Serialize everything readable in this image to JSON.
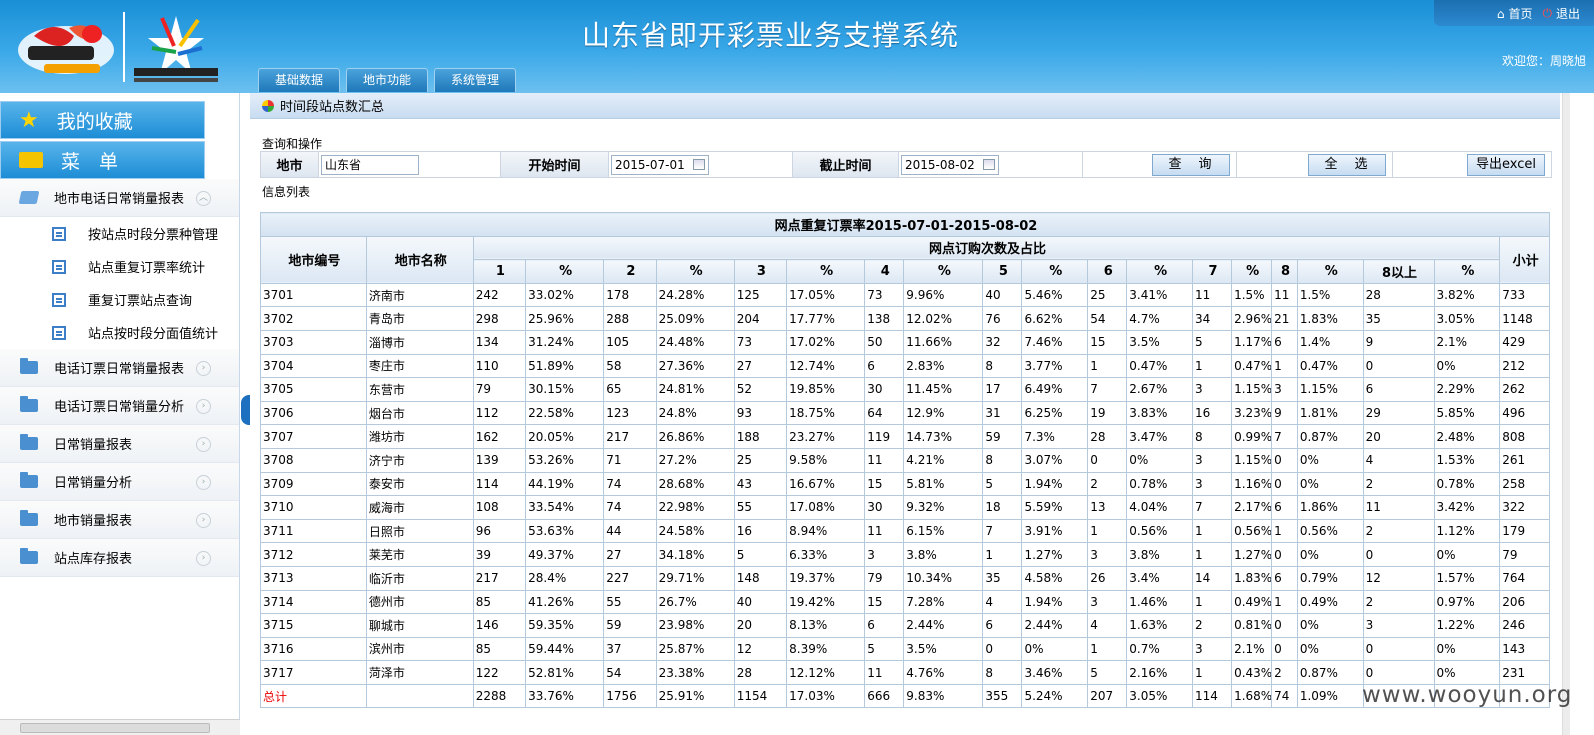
{
  "header": {
    "title": "山东省即开彩票业务支撑系统",
    "nav": [
      "基础数据",
      "地市功能",
      "系统管理"
    ],
    "home_label": "首页",
    "logout_label": "退出",
    "welcome": "欢迎您：周晓旭"
  },
  "sidebar": {
    "favorites_label": "我的收藏",
    "menu_label": "菜　单",
    "groups": [
      {
        "label": "地市电话日常销量报表",
        "expanded": true,
        "items": [
          "按站点时段分票种管理",
          "站点重复订票率统计",
          "重复订票站点查询",
          "站点按时段分面值统计"
        ]
      },
      {
        "label": "电话订票日常销量报表"
      },
      {
        "label": "电话订票日常销量分析"
      },
      {
        "label": "日常销量报表"
      },
      {
        "label": "日常销量分析"
      },
      {
        "label": "地市销量报表"
      },
      {
        "label": "站点库存报表"
      }
    ]
  },
  "breadcrumb": "时间段站点数汇总",
  "query": {
    "section_label": "查询和操作",
    "city_label": "地市",
    "city_value": "山东省",
    "start_label": "开始时间",
    "start_value": "2015-07-01",
    "end_label": "截止时间",
    "end_value": "2015-08-02",
    "search_btn": "查　询",
    "select_all_btn": "全　选",
    "export_btn": "导出excel"
  },
  "table": {
    "section_label": "信息列表",
    "title": "网点重复订票率2015-07-01-2015-08-02",
    "col_city_code": "地市编号",
    "col_city_name": "地市名称",
    "group_header": "网点订购次数及占比",
    "subheaders": [
      "1",
      "%",
      "2",
      "%",
      "3",
      "%",
      "4",
      "%",
      "5",
      "%",
      "6",
      "%",
      "7",
      "%",
      "8",
      "%",
      "8以上",
      "%"
    ],
    "col_subtotal": "小计",
    "rows": [
      [
        "3701",
        "济南市",
        "242",
        "33.02%",
        "178",
        "24.28%",
        "125",
        "17.05%",
        "73",
        "9.96%",
        "40",
        "5.46%",
        "25",
        "3.41%",
        "11",
        "1.5%",
        "11",
        "1.5%",
        "28",
        "3.82%",
        "733"
      ],
      [
        "3702",
        "青岛市",
        "298",
        "25.96%",
        "288",
        "25.09%",
        "204",
        "17.77%",
        "138",
        "12.02%",
        "76",
        "6.62%",
        "54",
        "4.7%",
        "34",
        "2.96%",
        "21",
        "1.83%",
        "35",
        "3.05%",
        "1148"
      ],
      [
        "3703",
        "淄博市",
        "134",
        "31.24%",
        "105",
        "24.48%",
        "73",
        "17.02%",
        "50",
        "11.66%",
        "32",
        "7.46%",
        "15",
        "3.5%",
        "5",
        "1.17%",
        "6",
        "1.4%",
        "9",
        "2.1%",
        "429"
      ],
      [
        "3704",
        "枣庄市",
        "110",
        "51.89%",
        "58",
        "27.36%",
        "27",
        "12.74%",
        "6",
        "2.83%",
        "8",
        "3.77%",
        "1",
        "0.47%",
        "1",
        "0.47%",
        "1",
        "0.47%",
        "0",
        "0%",
        "212"
      ],
      [
        "3705",
        "东营市",
        "79",
        "30.15%",
        "65",
        "24.81%",
        "52",
        "19.85%",
        "30",
        "11.45%",
        "17",
        "6.49%",
        "7",
        "2.67%",
        "3",
        "1.15%",
        "3",
        "1.15%",
        "6",
        "2.29%",
        "262"
      ],
      [
        "3706",
        "烟台市",
        "112",
        "22.58%",
        "123",
        "24.8%",
        "93",
        "18.75%",
        "64",
        "12.9%",
        "31",
        "6.25%",
        "19",
        "3.83%",
        "16",
        "3.23%",
        "9",
        "1.81%",
        "29",
        "5.85%",
        "496"
      ],
      [
        "3707",
        "潍坊市",
        "162",
        "20.05%",
        "217",
        "26.86%",
        "188",
        "23.27%",
        "119",
        "14.73%",
        "59",
        "7.3%",
        "28",
        "3.47%",
        "8",
        "0.99%",
        "7",
        "0.87%",
        "20",
        "2.48%",
        "808"
      ],
      [
        "3708",
        "济宁市",
        "139",
        "53.26%",
        "71",
        "27.2%",
        "25",
        "9.58%",
        "11",
        "4.21%",
        "8",
        "3.07%",
        "0",
        "0%",
        "3",
        "1.15%",
        "0",
        "0%",
        "4",
        "1.53%",
        "261"
      ],
      [
        "3709",
        "泰安市",
        "114",
        "44.19%",
        "74",
        "28.68%",
        "43",
        "16.67%",
        "15",
        "5.81%",
        "5",
        "1.94%",
        "2",
        "0.78%",
        "3",
        "1.16%",
        "0",
        "0%",
        "2",
        "0.78%",
        "258"
      ],
      [
        "3710",
        "威海市",
        "108",
        "33.54%",
        "74",
        "22.98%",
        "55",
        "17.08%",
        "30",
        "9.32%",
        "18",
        "5.59%",
        "13",
        "4.04%",
        "7",
        "2.17%",
        "6",
        "1.86%",
        "11",
        "3.42%",
        "322"
      ],
      [
        "3711",
        "日照市",
        "96",
        "53.63%",
        "44",
        "24.58%",
        "16",
        "8.94%",
        "11",
        "6.15%",
        "7",
        "3.91%",
        "1",
        "0.56%",
        "1",
        "0.56%",
        "1",
        "0.56%",
        "2",
        "1.12%",
        "179"
      ],
      [
        "3712",
        "莱芜市",
        "39",
        "49.37%",
        "27",
        "34.18%",
        "5",
        "6.33%",
        "3",
        "3.8%",
        "1",
        "1.27%",
        "3",
        "3.8%",
        "1",
        "1.27%",
        "0",
        "0%",
        "0",
        "0%",
        "79"
      ],
      [
        "3713",
        "临沂市",
        "217",
        "28.4%",
        "227",
        "29.71%",
        "148",
        "19.37%",
        "79",
        "10.34%",
        "35",
        "4.58%",
        "26",
        "3.4%",
        "14",
        "1.83%",
        "6",
        "0.79%",
        "12",
        "1.57%",
        "764"
      ],
      [
        "3714",
        "德州市",
        "85",
        "41.26%",
        "55",
        "26.7%",
        "40",
        "19.42%",
        "15",
        "7.28%",
        "4",
        "1.94%",
        "3",
        "1.46%",
        "1",
        "0.49%",
        "1",
        "0.49%",
        "2",
        "0.97%",
        "206"
      ],
      [
        "3715",
        "聊城市",
        "146",
        "59.35%",
        "59",
        "23.98%",
        "20",
        "8.13%",
        "6",
        "2.44%",
        "6",
        "2.44%",
        "4",
        "1.63%",
        "2",
        "0.81%",
        "0",
        "0%",
        "3",
        "1.22%",
        "246"
      ],
      [
        "3716",
        "滨州市",
        "85",
        "59.44%",
        "37",
        "25.87%",
        "12",
        "8.39%",
        "5",
        "3.5%",
        "0",
        "0%",
        "1",
        "0.7%",
        "3",
        "2.1%",
        "0",
        "0%",
        "0",
        "0%",
        "143"
      ],
      [
        "3717",
        "菏泽市",
        "122",
        "52.81%",
        "54",
        "23.38%",
        "28",
        "12.12%",
        "11",
        "4.76%",
        "8",
        "3.46%",
        "5",
        "2.16%",
        "1",
        "0.43%",
        "2",
        "0.87%",
        "0",
        "0%",
        "231"
      ],
      [
        "总计",
        "",
        "2288",
        "33.76%",
        "1756",
        "25.91%",
        "1154",
        "17.03%",
        "666",
        "9.83%",
        "355",
        "5.24%",
        "207",
        "3.05%",
        "114",
        "1.68%",
        "74",
        "1.09%",
        "",
        "",
        ""
      ]
    ]
  },
  "watermark": "www.wooyun.org"
}
